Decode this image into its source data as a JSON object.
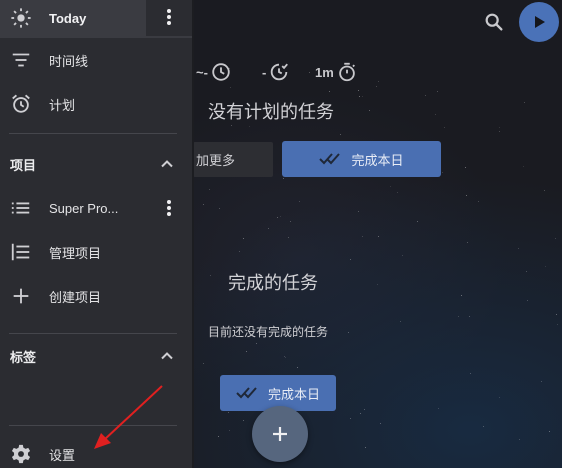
{
  "main": {
    "stats": [
      {
        "text": "~-",
        "icon": "clock-icon"
      },
      {
        "text": "-",
        "icon": "clock-check-icon"
      },
      {
        "text": "1m",
        "icon": "stopwatch-icon"
      }
    ],
    "no_planned_title": "没有计划的任务",
    "add_more_label": "加更多",
    "finish_today_label": "完成本日",
    "completed_title": "完成的任务",
    "no_completed_text": "目前还没有完成的任务",
    "finish_today_label_2": "完成本日"
  },
  "drawer": {
    "items": [
      {
        "label": "Today",
        "icon": "sun-icon"
      },
      {
        "label": "时间线",
        "icon": "timeline-icon"
      },
      {
        "label": "计划",
        "icon": "alarm-icon"
      }
    ],
    "projects_header": "项目",
    "projects": [
      {
        "label": "Super Pro...",
        "icon": "list-icon"
      },
      {
        "label": "管理项目",
        "icon": "manage-list-icon"
      },
      {
        "label": "创建项目",
        "icon": "plus-icon"
      }
    ],
    "tags_header": "标签",
    "settings_label": "设置"
  },
  "colors": {
    "accent": "#4a72b8",
    "drawer_bg": "#2b2c31",
    "arrow": "#e02020"
  }
}
